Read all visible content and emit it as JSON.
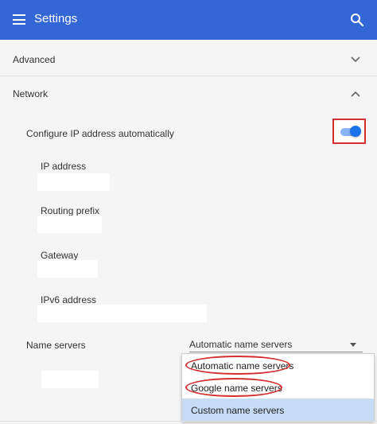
{
  "header": {
    "title": "Settings",
    "menu_icon": "hamburger-menu-icon",
    "search_icon": "search-icon",
    "color": "#3367d6"
  },
  "sections": {
    "advanced": {
      "label": "Advanced",
      "icon": "chevron-down-icon"
    },
    "network": {
      "label": "Network",
      "icon": "chevron-up-icon"
    }
  },
  "network": {
    "auto_ip": {
      "label": "Configure IP address automatically",
      "enabled": true
    },
    "fields": [
      {
        "label": "IP address",
        "value": ""
      },
      {
        "label": "Routing prefix",
        "value": ""
      },
      {
        "label": "Gateway",
        "value": ""
      },
      {
        "label": "IPv6 address",
        "value": ""
      }
    ],
    "name_servers": {
      "label": "Name servers",
      "selected": "Automatic name servers",
      "options": [
        "Automatic name servers",
        "Google name servers",
        "Custom name servers"
      ],
      "highlighted_option": "Custom name servers"
    }
  },
  "colors": {
    "accent": "#1a73e8",
    "annotation": "#d32f2f",
    "highlight": "#c6dcf5"
  }
}
